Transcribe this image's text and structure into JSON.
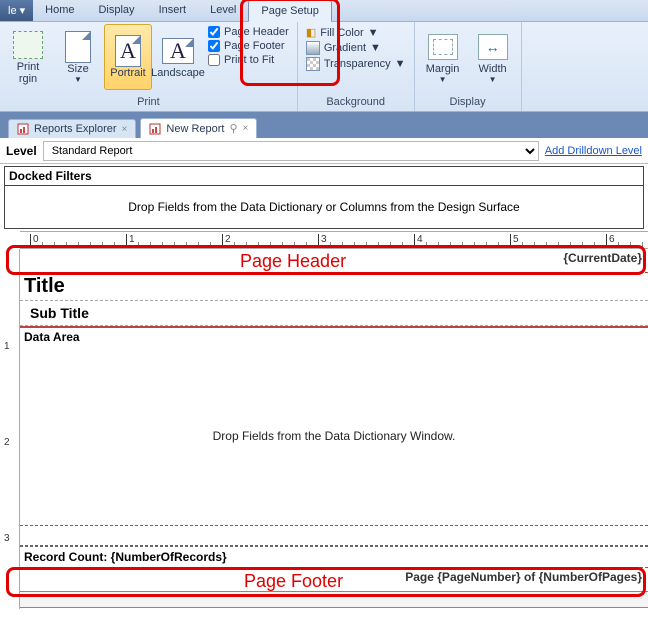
{
  "ribbon_tabs": {
    "left_label": "le ▾",
    "items": [
      "Home",
      "Display",
      "Insert",
      "Level",
      "Page Setup"
    ],
    "active_index": 4
  },
  "ribbon": {
    "groups": {
      "print": {
        "title": "Print",
        "print_margin": "Print\nrgin",
        "size": "Size",
        "portrait": "Portrait",
        "landscape": "Landscape",
        "page_header_chk": "Page Header",
        "page_footer_chk": "Page Footer",
        "print_to_fit_chk": "Print to Fit"
      },
      "background": {
        "title": "Background",
        "fill_color": "Fill Color",
        "gradient": "Gradient",
        "transparency": "Transparency"
      },
      "display": {
        "title": "Display",
        "margin": "Margin",
        "width": "Width"
      }
    }
  },
  "doc_tabs": {
    "items": [
      {
        "label": "Reports Explorer"
      },
      {
        "label": "New Report"
      }
    ],
    "active_index": 1
  },
  "level_bar": {
    "label": "Level",
    "value": "Standard Report",
    "link": "Add Drilldown Level"
  },
  "designer": {
    "docked_filters_title": "Docked Filters",
    "docked_filters_hint": "Drop Fields from the Data Dictionary or Columns from the Design Surface",
    "page_header_value": "{CurrentDate}",
    "title_text": "Title",
    "subtitle_text": "Sub Title",
    "data_area_label": "Data Area",
    "data_area_hint": "Drop Fields from the Data Dictionary Window.",
    "record_count_text": "Record Count: {NumberOfRecords}",
    "page_footer_value": "Page {PageNumber} of {NumberOfPages}"
  },
  "annotations": {
    "page_header": "Page Header",
    "page_footer": "Page Footer"
  },
  "ruler_h": {
    "majors": [
      0,
      1,
      2,
      3,
      4,
      5,
      6
    ]
  },
  "ruler_v": {
    "majors": [
      1,
      2,
      3
    ]
  }
}
